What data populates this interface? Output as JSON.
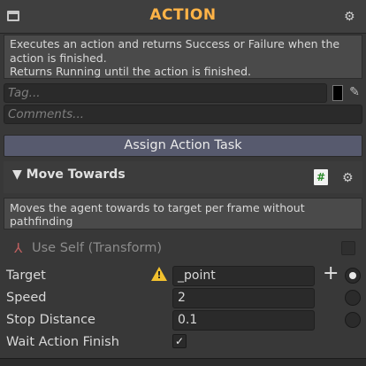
{
  "header": {
    "title": "ACTION",
    "settings_icon": "gear-icon",
    "node_icon": "window-icon",
    "title_color": "#ffb347"
  },
  "description": "Executes an action and returns Success or Failure when the action is finished.\nReturns Running until the action is finished.",
  "tag": {
    "placeholder": "Tag...",
    "color": "#000000",
    "picker_icon": "eyedropper-icon"
  },
  "comments": {
    "placeholder": "Comments..."
  },
  "assign_button": {
    "label": "Assign Action Task"
  },
  "task": {
    "title": "Move Towards",
    "collapse_icon": "triangle-down-icon",
    "script_icon": "#",
    "description": "Moves the agent towards to target per frame without pathfinding",
    "use_self": {
      "label": "Use Self (Transform)",
      "checked": false
    },
    "fields": [
      {
        "label": "Target",
        "value": "_point",
        "warning": true,
        "selected": true
      },
      {
        "label": "Speed",
        "value": "2",
        "selected": false
      },
      {
        "label": "Stop Distance",
        "value": "0.1",
        "selected": false
      }
    ],
    "wait_action_finish": {
      "label": "Wait Action Finish",
      "checked": true
    }
  }
}
